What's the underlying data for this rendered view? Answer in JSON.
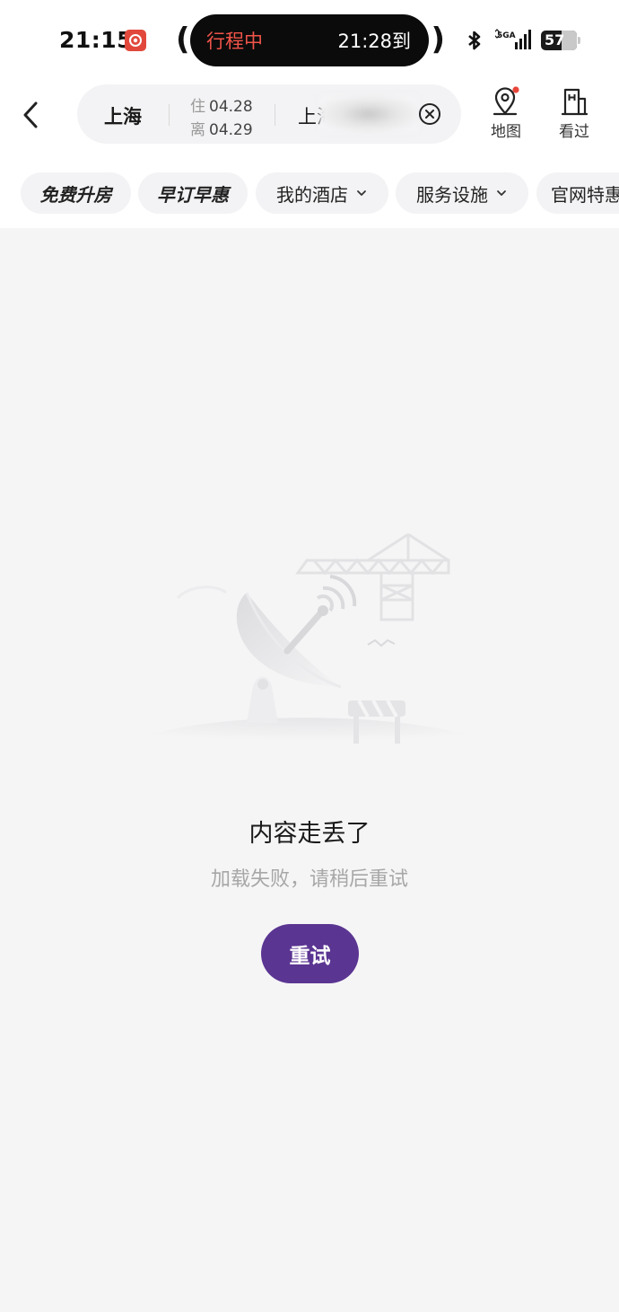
{
  "status_bar": {
    "time": "21:15",
    "island_trip": "行程中",
    "island_eta": "21:28到",
    "network": "5GA",
    "battery": "57",
    "battery_level": 0.57,
    "icons": [
      "app-badge-icon",
      "bluetooth-icon",
      "signal-icon",
      "battery-icon"
    ]
  },
  "search": {
    "city": "上海",
    "checkin_label": "住",
    "checkin_date": "04.28",
    "checkout_label": "离",
    "checkout_date": "04.29",
    "keyword": "上海"
  },
  "top_actions": [
    {
      "label": "地图",
      "icon": "map-pin-icon"
    },
    {
      "label": "看过",
      "icon": "viewed-hotel-icon"
    }
  ],
  "filters": [
    {
      "label": "免费升房",
      "style": "promo"
    },
    {
      "label": "早订早惠",
      "style": "promo"
    },
    {
      "label": "我的酒店",
      "has_dropdown": true
    },
    {
      "label": "服务设施",
      "has_dropdown": true
    },
    {
      "label": "官网特惠"
    }
  ],
  "empty_state": {
    "title": "内容走丢了",
    "subtitle": "加载失败，请稍后重试",
    "retry_label": "重试"
  },
  "colors": {
    "accent": "#5b3592",
    "trip_text": "#f0544a",
    "page_bg": "#f5f5f6",
    "notification_dot": "#e8463a"
  }
}
